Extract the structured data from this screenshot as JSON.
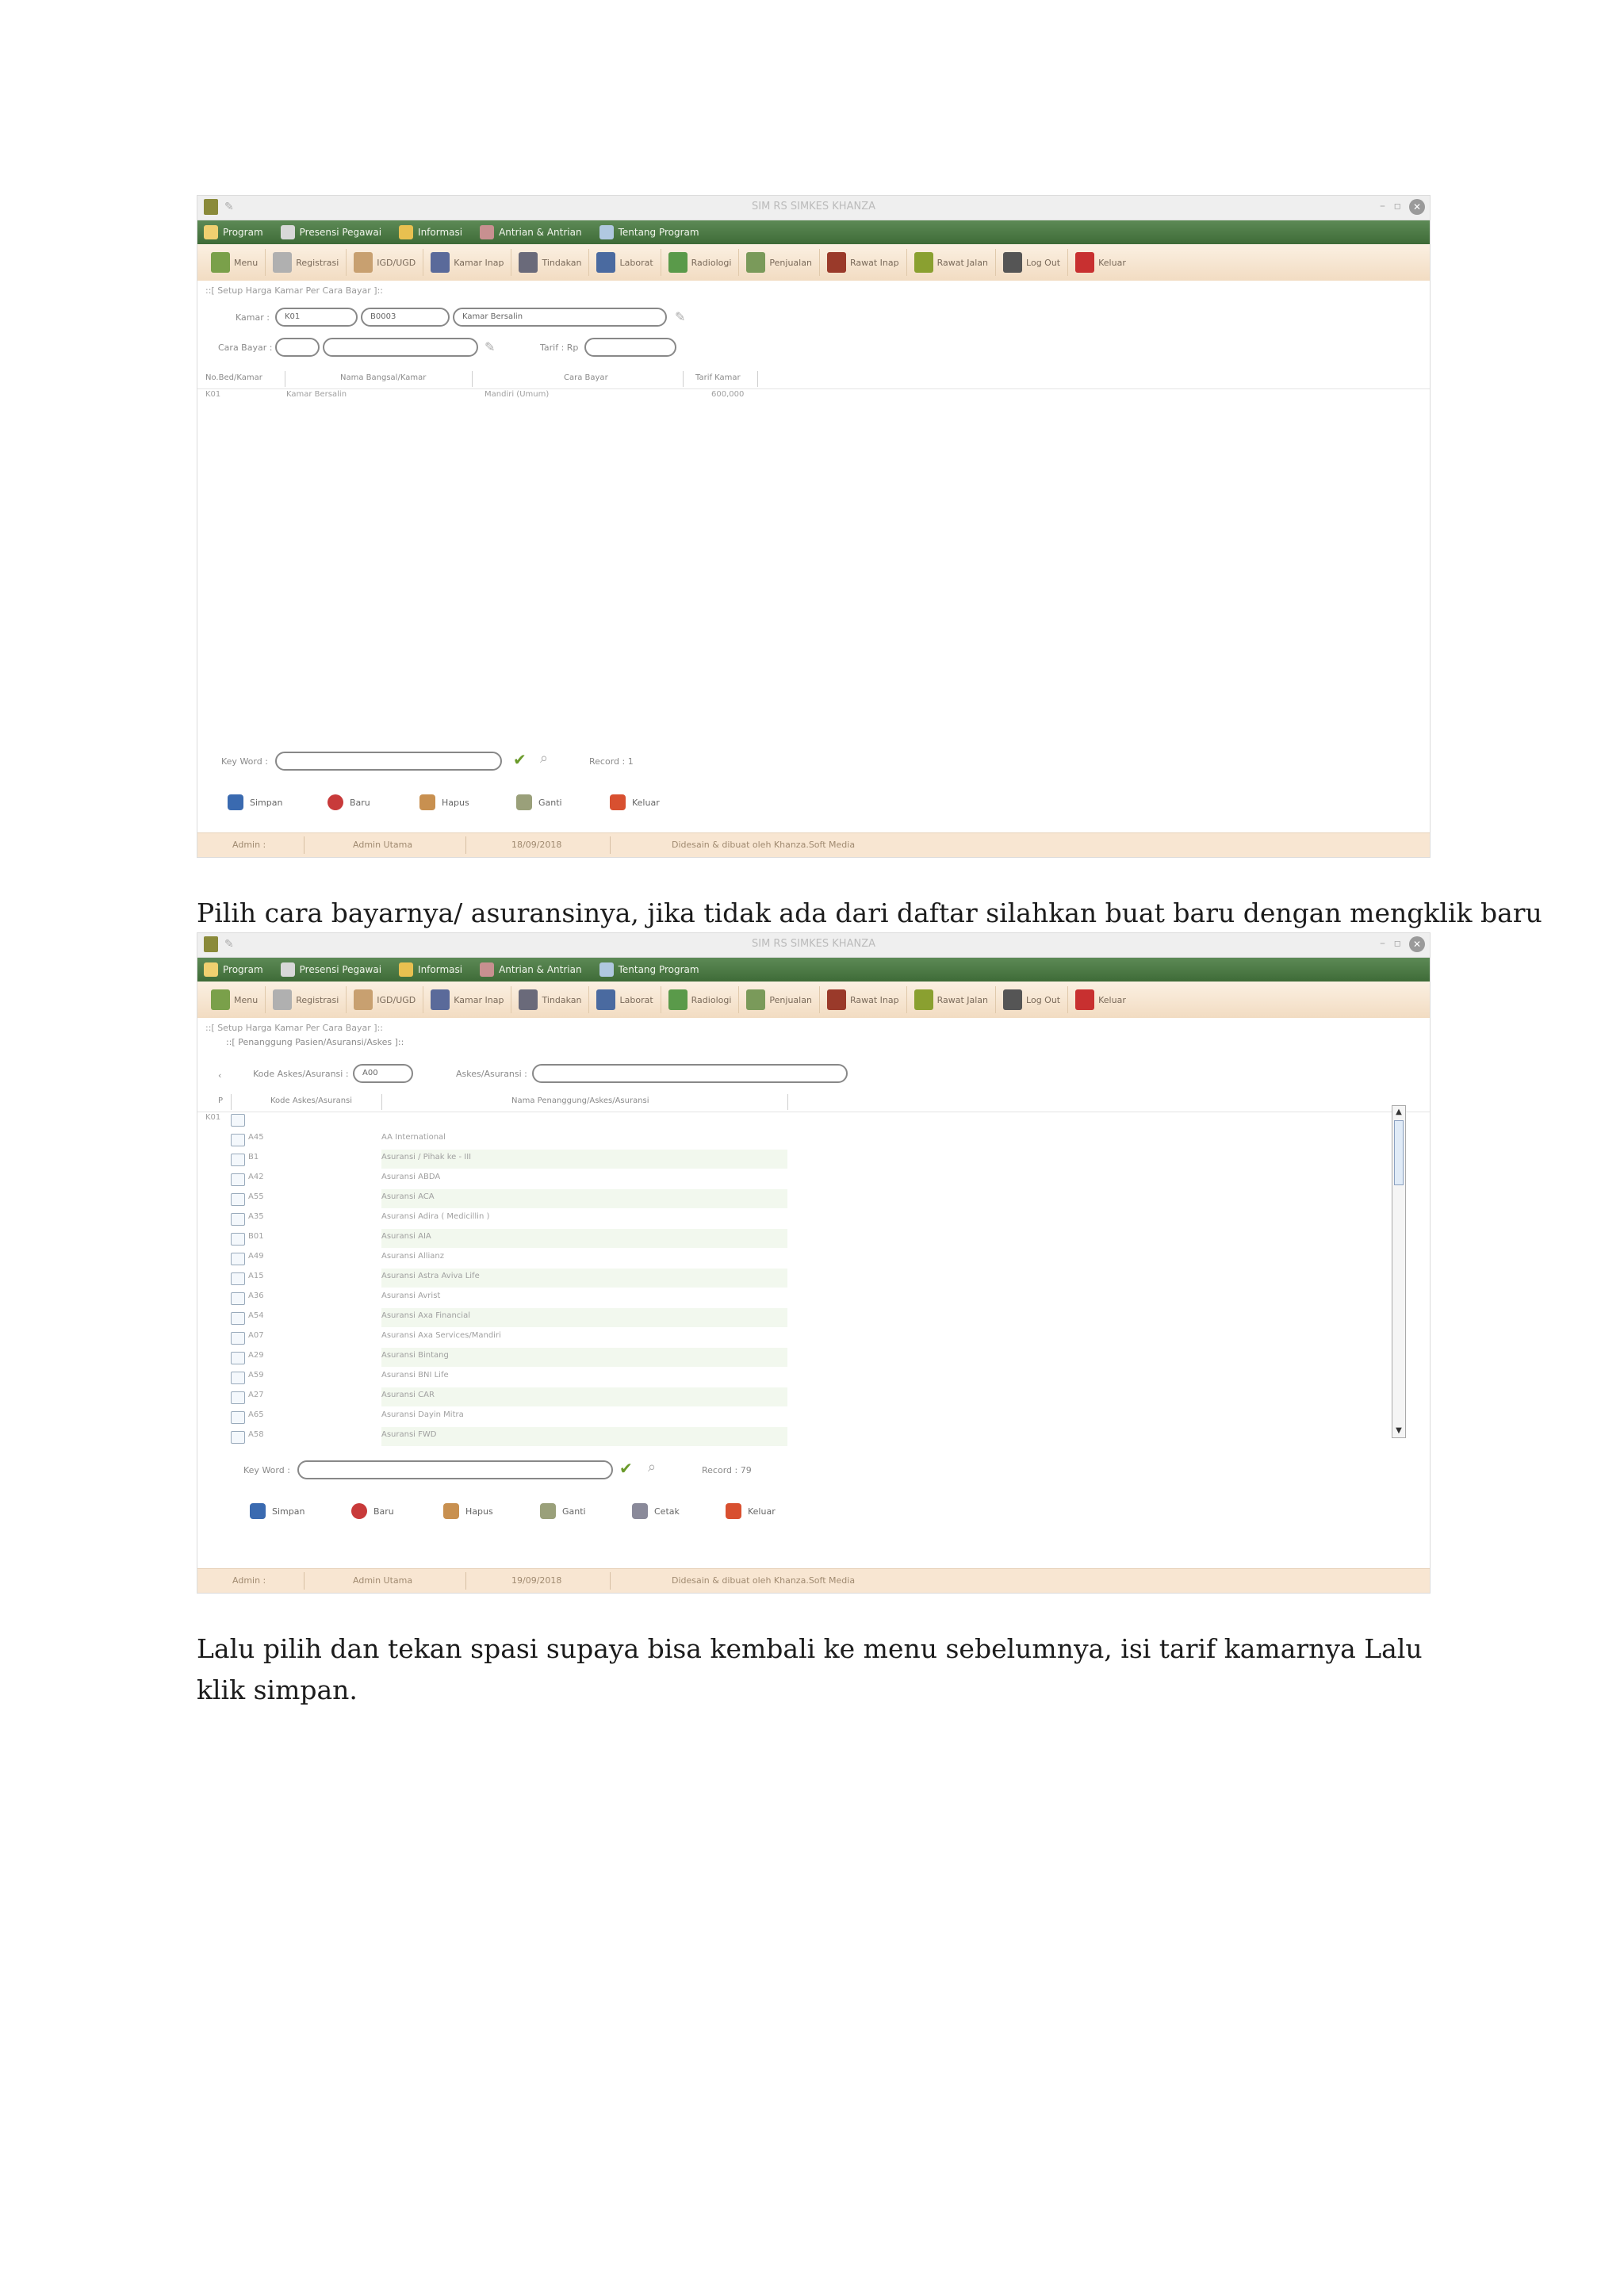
{
  "window": {
    "title": "SIM RS SIMKES KHANZA"
  },
  "menubar": [
    {
      "label": "Program",
      "icon": "program-icon"
    },
    {
      "label": "Presensi Pegawai",
      "icon": "presensi-icon"
    },
    {
      "label": "Informasi",
      "icon": "informasi-icon"
    },
    {
      "label": "Antrian & Antrian",
      "icon": "antrian-icon"
    },
    {
      "label": "Tentang Program",
      "icon": "tentang-icon"
    }
  ],
  "toolbar": [
    {
      "label": "Menu",
      "color": "#7aa04a"
    },
    {
      "label": "Registrasi",
      "color": "#b0b0b0"
    },
    {
      "label": "IGD/UGD",
      "color": "#c8a070"
    },
    {
      "label": "Kamar Inap",
      "color": "#5a6a9a"
    },
    {
      "label": "Tindakan",
      "color": "#6a6a7a"
    },
    {
      "label": "Laborat",
      "color": "#4a6aa0"
    },
    {
      "label": "Radiologi",
      "color": "#5a9a4a"
    },
    {
      "label": "Penjualan",
      "color": "#7a9a5a"
    },
    {
      "label": "Rawat Inap",
      "color": "#9a3a2a"
    },
    {
      "label": "Rawat Jalan",
      "color": "#8aa030"
    },
    {
      "label": "Log Out",
      "color": "#555555"
    },
    {
      "label": "Keluar",
      "color": "#c83030"
    }
  ],
  "screen1": {
    "panel_title": "::[ Setup Harga Kamar Per Cara Bayar ]::",
    "kamar_label": "Kamar :",
    "kamar_code": "K01",
    "kamar_bangsal": "B0003",
    "kamar_name": "Kamar Bersalin",
    "cara_bayar_label": "Cara Bayar :",
    "tarif_label": "Tarif : Rp",
    "columns": [
      "No.Bed/Kamar",
      "Nama Bangsal/Kamar",
      "Cara Bayar",
      "Tarif Kamar"
    ],
    "rows": [
      [
        "K01",
        "Kamar Bersalin",
        "Mandiri (Umum)",
        "600,000"
      ]
    ],
    "keyword_label": "Key Word :",
    "record_label": "Record : 1",
    "actions": [
      "Simpan",
      "Baru",
      "Hapus",
      "Ganti",
      "Keluar"
    ],
    "status": [
      "Admin :",
      "Admin Utama",
      "18/09/2018",
      "Didesain & dibuat oleh Khanza.Soft Media"
    ]
  },
  "caption1": "Pilih cara bayarnya/ asuransinya, jika tidak ada dari daftar silahkan buat baru dengan mengklik baru",
  "screen2": {
    "panel_title": "::[ Setup Harga Kamar Per Cara Bayar ]::",
    "sub_title": "::[ Penanggung Pasien/Asuransi/Askes ]::",
    "kode_label": "Kode Askes/Asuransi :",
    "kode_value": "A00",
    "askes_label": "Askes/Asuransi :",
    "columns": [
      "Kode Askes/Asuransi",
      "Nama Penanggung/Askes/Asuransi"
    ],
    "first_row_code": "K01",
    "rows": [
      [
        "A45",
        "AA International"
      ],
      [
        "B1",
        "Asuransi / Pihak ke - III"
      ],
      [
        "A42",
        "Asuransi ABDA"
      ],
      [
        "A55",
        "Asuransi ACA"
      ],
      [
        "A35",
        "Asuransi Adira ( Medicillin )"
      ],
      [
        "B01",
        "Asuransi AIA"
      ],
      [
        "A49",
        "Asuransi Allianz"
      ],
      [
        "A15",
        "Asuransi Astra Aviva Life"
      ],
      [
        "A36",
        "Asuransi Avrist"
      ],
      [
        "A54",
        "Asuransi Axa Financial"
      ],
      [
        "A07",
        "Asuransi Axa Services/Mandiri"
      ],
      [
        "A29",
        "Asuransi Bintang"
      ],
      [
        "A59",
        "Asuransi BNI Life"
      ],
      [
        "A27",
        "Asuransi CAR"
      ],
      [
        "A65",
        "Asuransi Dayin Mitra"
      ],
      [
        "A58",
        "Asuransi FWD"
      ]
    ],
    "keyword_label": "Key Word :",
    "record_label": "Record : 79",
    "actions": [
      "Simpan",
      "Baru",
      "Hapus",
      "Ganti",
      "Cetak",
      "Keluar"
    ],
    "status": [
      "Admin :",
      "Admin Utama",
      "19/09/2018",
      "Didesain & dibuat oleh Khanza.Soft Media"
    ]
  },
  "caption2": "Lalu pilih dan tekan spasi supaya bisa kembali ke menu sebelumnya, isi tarif kamarnya Lalu klik simpan."
}
